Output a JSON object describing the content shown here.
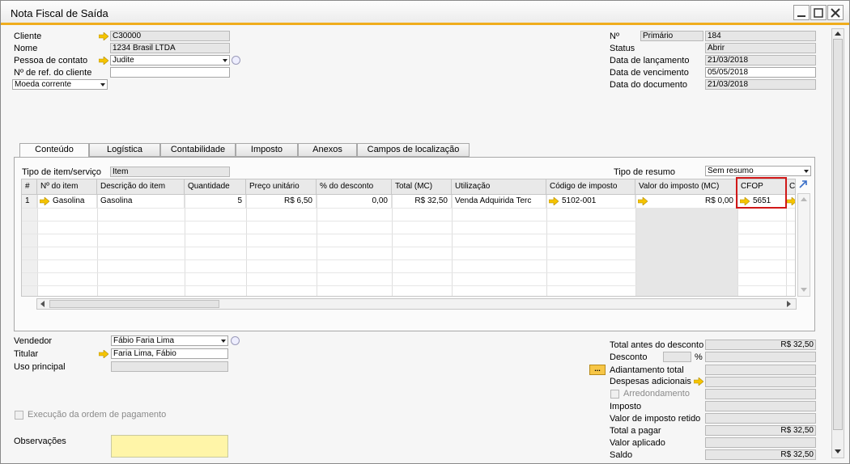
{
  "window": {
    "title": "Nota Fiscal de Saída"
  },
  "header_left": {
    "cliente_label": "Cliente",
    "cliente_value": "C30000",
    "nome_label": "Nome",
    "nome_value": "1234 Brasil LTDA",
    "contato_label": "Pessoa de contato",
    "contato_value": "Judite",
    "ref_label": "Nº de ref. do cliente",
    "ref_value": "",
    "moeda_value": "Moeda corrente"
  },
  "header_right": {
    "no_label": "Nº",
    "serie_value": "Primário",
    "no_value": "184",
    "status_label": "Status",
    "status_value": "Abrir",
    "lancamento_label": "Data de lançamento",
    "lancamento_value": "21/03/2018",
    "vencimento_label": "Data de vencimento",
    "vencimento_value": "05/05/2018",
    "documento_label": "Data do documento",
    "documento_value": "21/03/2018"
  },
  "tabs": [
    "Conteúdo",
    "Logística",
    "Contabilidade",
    "Imposto",
    "Anexos",
    "Campos de localização"
  ],
  "content": {
    "tipo_item_label": "Tipo de item/serviço",
    "tipo_item_value": "Item",
    "tipo_resumo_label": "Tipo de resumo",
    "tipo_resumo_value": "Sem resumo"
  },
  "grid": {
    "headers": [
      "#",
      "Nº do item",
      "Descrição do item",
      "Quantidade",
      "Preço unitário",
      "% do desconto",
      "Total (MC)",
      "Utilização",
      "Código de imposto",
      "Valor do imposto (MC)",
      "CFOP",
      "C"
    ],
    "rows": [
      {
        "num": "1",
        "item": "Gasolina",
        "descricao": "Gasolina",
        "quantidade": "5",
        "preco": "R$ 6,50",
        "desconto": "0,00",
        "total": "R$ 32,50",
        "utilizacao": "Venda Adquirida Terc",
        "codigo": "5102-001",
        "valor_imposto": "R$ 0,00",
        "cfop": "5651"
      }
    ]
  },
  "footer_left": {
    "vendedor_label": "Vendedor",
    "vendedor_value": "Fábio Faria Lima",
    "titular_label": "Titular",
    "titular_value": "Faria Lima, Fábio",
    "uso_label": "Uso principal",
    "uso_value": "",
    "execucao_label": "Execução da ordem de pagamento",
    "observacoes_label": "Observações"
  },
  "footer_right": {
    "total_antes_label": "Total antes do desconto",
    "total_antes_value": "R$ 32,50",
    "desconto_label": "Desconto",
    "desconto_pct": "%",
    "adiantamento_label": "Adiantamento total",
    "ellipsis": "...",
    "despesas_label": "Despesas adicionais",
    "arredondamento_label": "Arredondamento",
    "imposto_label": "Imposto",
    "retido_label": "Valor de imposto retido",
    "total_pagar_label": "Total a pagar",
    "total_pagar_value": "R$ 32,50",
    "aplicado_label": "Valor aplicado",
    "saldo_label": "Saldo",
    "saldo_value": "R$ 32,50"
  },
  "colors": {
    "accent": "#f0ad1d",
    "link_arrow": "#f5c400",
    "highlight": "#d11818",
    "note_bg": "#fff5a8"
  }
}
